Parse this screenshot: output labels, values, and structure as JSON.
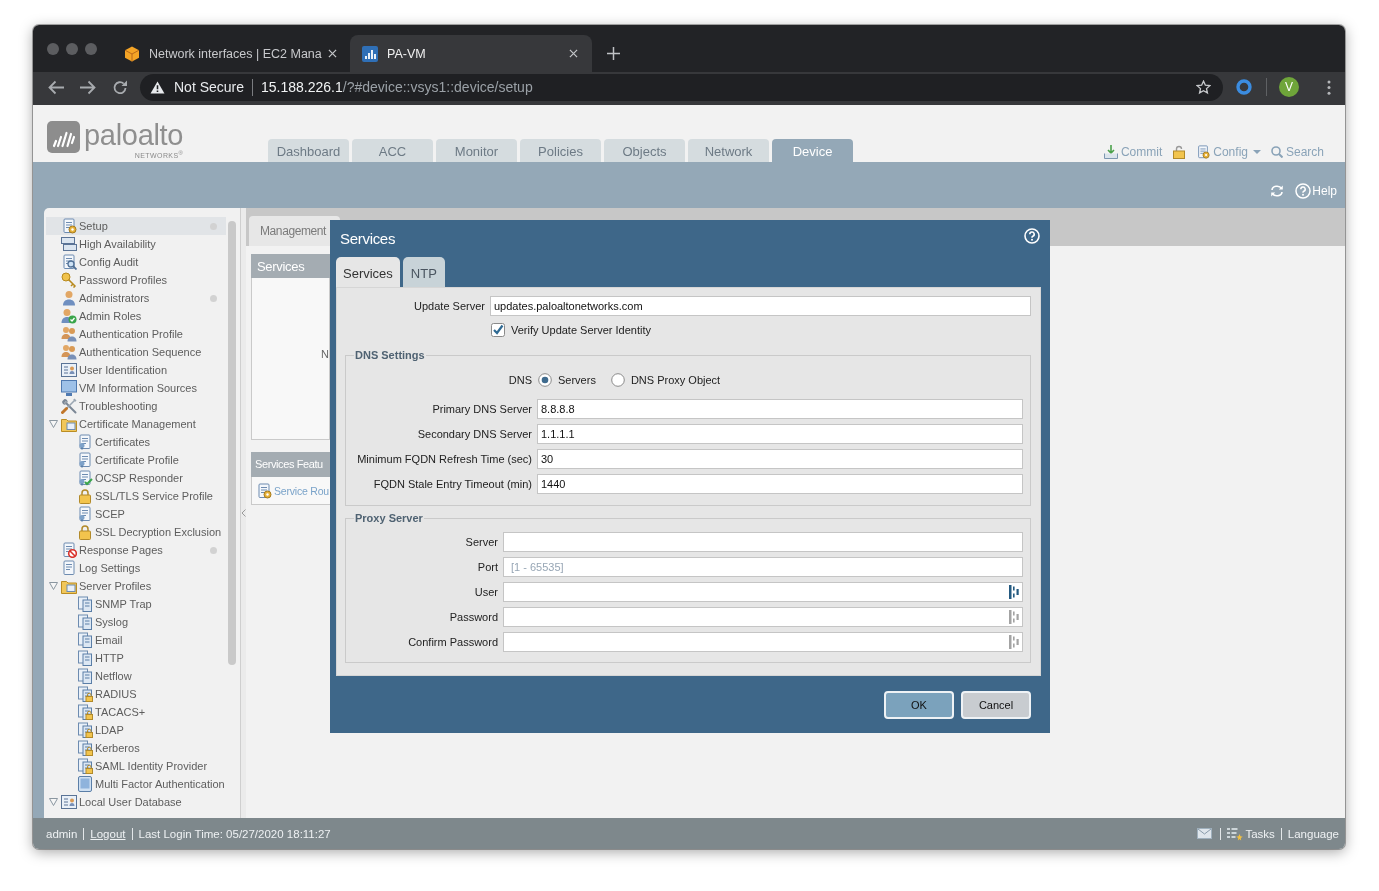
{
  "browser": {
    "tabs": [
      {
        "title": "Network interfaces | EC2 Mana",
        "selected": false
      },
      {
        "title": "PA-VM",
        "selected": true
      }
    ],
    "address": {
      "security": "Not Secure",
      "host": "15.188.226.1",
      "path": "/?#device::vsys1::device/setup"
    },
    "profile": "V"
  },
  "header": {
    "logo": {
      "name": "paloalto",
      "tagline": "NETWORKS$^{®}$"
    },
    "tabs": [
      {
        "label": "Dashboard",
        "selected": false
      },
      {
        "label": "ACC",
        "selected": false
      },
      {
        "label": "Monitor",
        "selected": false
      },
      {
        "label": "Policies",
        "selected": false
      },
      {
        "label": "Objects",
        "selected": false
      },
      {
        "label": "Network",
        "selected": false
      },
      {
        "label": "Device",
        "selected": true
      }
    ],
    "actions": [
      {
        "kind": "commit",
        "label": "Commit"
      },
      {
        "kind": "lock"
      },
      {
        "kind": "config",
        "label": "Config"
      },
      {
        "kind": "search",
        "label": "Search"
      }
    ],
    "help": "Help"
  },
  "sidebar": {
    "items": [
      {
        "label": "Setup",
        "selected": true,
        "indicator": true
      },
      {
        "label": "High Availability",
        "selected": false,
        "indicator": false
      },
      {
        "label": "Config Audit",
        "selected": false,
        "indicator": false
      },
      {
        "label": "Password Profiles",
        "selected": false,
        "indicator": false
      },
      {
        "label": "Administrators",
        "selected": false,
        "indicator": true
      },
      {
        "label": "Admin Roles",
        "selected": false,
        "indicator": false
      },
      {
        "label": "Authentication Profile",
        "selected": false,
        "indicator": false
      },
      {
        "label": "Authentication Sequence",
        "selected": false,
        "indicator": false
      },
      {
        "label": "User Identification",
        "selected": false,
        "indicator": false
      },
      {
        "label": "VM Information Sources",
        "selected": false,
        "indicator": false
      },
      {
        "label": "Troubleshooting",
        "selected": false,
        "indicator": false
      },
      {
        "label": "Certificate Management",
        "selected": false,
        "indicator": false,
        "expanded": true,
        "children": [
          {
            "label": "Certificates",
            "selected": false
          },
          {
            "label": "Certificate Profile",
            "selected": false
          },
          {
            "label": "OCSP Responder",
            "selected": false
          },
          {
            "label": "SSL/TLS Service Profile",
            "selected": false
          },
          {
            "label": "SCEP",
            "selected": false
          },
          {
            "label": "SSL Decryption Exclusion",
            "selected": false
          }
        ]
      },
      {
        "label": "Response Pages",
        "selected": false,
        "indicator": true
      },
      {
        "label": "Log Settings",
        "selected": false,
        "indicator": false
      },
      {
        "label": "Server Profiles",
        "selected": false,
        "indicator": false,
        "expanded": true,
        "children": [
          {
            "label": "SNMP Trap",
            "selected": false
          },
          {
            "label": "Syslog",
            "selected": false
          },
          {
            "label": "Email",
            "selected": false
          },
          {
            "label": "HTTP",
            "selected": false
          },
          {
            "label": "Netflow",
            "selected": false
          },
          {
            "label": "RADIUS",
            "selected": false
          },
          {
            "label": "TACACS+",
            "selected": false
          },
          {
            "label": "LDAP",
            "selected": false
          },
          {
            "label": "Kerberos",
            "selected": false
          },
          {
            "label": "SAML Identity Provider",
            "selected": false
          },
          {
            "label": "Multi Factor Authentication",
            "selected": false
          }
        ]
      },
      {
        "label": "Local User Database",
        "selected": false,
        "indicator": false,
        "expanded": true
      }
    ]
  },
  "content": {
    "tab": "Management",
    "panels": [
      {
        "title": "Services",
        "text": "N"
      },
      {
        "title": "Services Featu",
        "link": "Service Rou"
      }
    ]
  },
  "dialog": {
    "title": "Services",
    "tabs": [
      {
        "label": "Services",
        "selected": true
      },
      {
        "label": "NTP",
        "selected": false
      }
    ],
    "update_server": {
      "label": "Update Server",
      "value": "updates.paloaltonetworks.com"
    },
    "verify": {
      "label": "Verify Update Server Identity",
      "checked": true
    },
    "dns_settings": {
      "legend": "DNS Settings",
      "dns_label": "DNS",
      "options": [
        {
          "label": "Servers",
          "selected": true
        },
        {
          "label": "DNS Proxy Object",
          "selected": false
        }
      ],
      "fields": [
        {
          "label": "Primary DNS Server",
          "value": "8.8.8.8"
        },
        {
          "label": "Secondary DNS Server",
          "value": "1.1.1.1"
        },
        {
          "label": "Minimum FQDN Refresh Time (sec)",
          "value": "30"
        },
        {
          "label": "FQDN Stale Entry Timeout (min)",
          "value": "1440"
        }
      ]
    },
    "proxy_server": {
      "legend": "Proxy Server",
      "fields": [
        {
          "label": "Server",
          "kind": "text"
        },
        {
          "label": "Port",
          "kind": "text",
          "placeholder": "[1 - 65535]"
        },
        {
          "label": "User",
          "kind": "credential",
          "active": true
        },
        {
          "label": "Password",
          "kind": "credential",
          "active": false
        },
        {
          "label": "Confirm Password",
          "kind": "credential",
          "active": false
        }
      ]
    },
    "buttons": [
      {
        "label": "OK",
        "kind": "primary"
      },
      {
        "label": "Cancel",
        "kind": "secondary"
      }
    ]
  },
  "status_bar": {
    "user": "admin",
    "logout": "Logout",
    "last_login": "Last Login Time: 05/27/2020 18:11:27",
    "tasks": "Tasks",
    "language": "Language"
  }
}
